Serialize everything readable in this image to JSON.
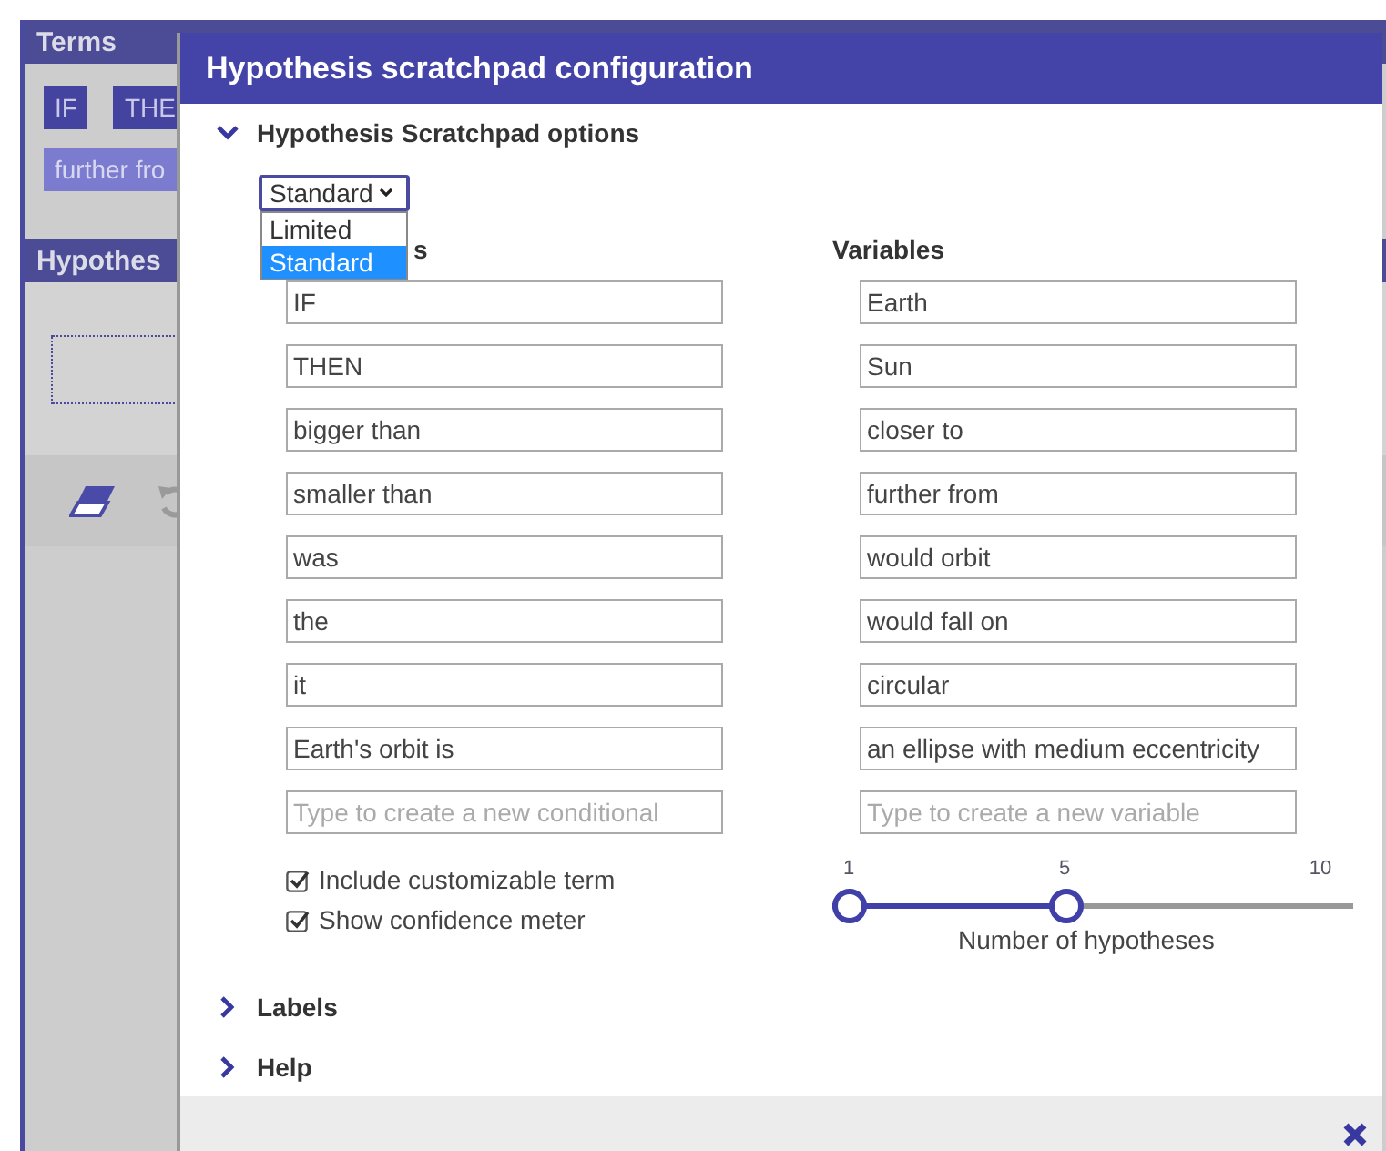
{
  "background": {
    "terms_header": "Terms",
    "terms": [
      {
        "label": "IF",
        "kind": "word"
      },
      {
        "label": "THE",
        "kind": "word"
      },
      {
        "label": "further fro",
        "kind": "variable"
      }
    ],
    "hypotheses_header": "Hypothes"
  },
  "dialog": {
    "title": "Hypothesis scratchpad configuration",
    "sections": [
      {
        "title": "Hypothesis Scratchpad options",
        "expanded": true
      },
      {
        "title": "Labels",
        "expanded": false
      },
      {
        "title": "Help",
        "expanded": false
      }
    ],
    "mode_select": {
      "value": "Standard",
      "options": [
        {
          "label": "Limited",
          "selected": false
        },
        {
          "label": "Standard",
          "selected": true
        }
      ]
    },
    "columns": [
      {
        "heading": "s",
        "fields": [
          "IF",
          "THEN",
          "bigger than",
          "smaller than",
          "was",
          "the",
          "it",
          "Earth's orbit is"
        ],
        "placeholder": "Type to create a new conditional"
      },
      {
        "heading": "Variables",
        "fields": [
          "Earth",
          "Sun",
          "closer to",
          "further from",
          "would orbit",
          "would fall on",
          "circular",
          "an ellipse with medium eccentricity"
        ],
        "placeholder": "Type to create a new variable"
      }
    ],
    "checkboxes": [
      {
        "label": "Include customizable term",
        "checked": true
      },
      {
        "label": "Show confidence meter",
        "checked": true
      }
    ],
    "slider": {
      "label": "Number of hypotheses",
      "min_label": "1",
      "value_label": "5",
      "max_label": "10",
      "level": 0.444
    }
  }
}
